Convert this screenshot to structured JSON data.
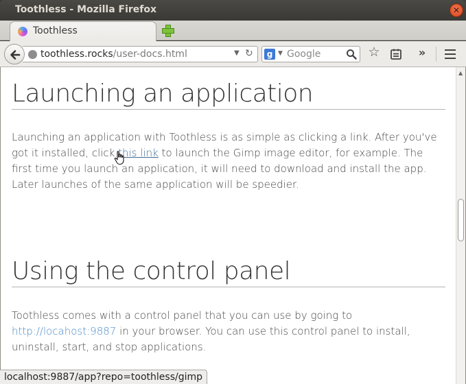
{
  "window": {
    "title": "Toothless - Mozilla Firefox",
    "close_glyph": "✕"
  },
  "tabs": [
    {
      "label": "Toothless",
      "favicon": "toothless-favicon-icon"
    }
  ],
  "navbar": {
    "url_domain": "toothless.rocks",
    "url_path": "/user-docs.html",
    "search_engine": "google-icon",
    "search_placeholder": "Google",
    "overflow_glyph": "»",
    "star_glyph": "☆"
  },
  "content": {
    "heading1": "Launching an application",
    "para1_before": "Launching an application with Toothless is as simple as clicking a link. After you've got it installed, click ",
    "para1_link": "this link",
    "para1_after": " to launch the Gimp image editor, for example. The first time you launch an application, it will need to download and install the app. Later launches of the same application will be speedier.",
    "heading2": "Using the control panel",
    "para2_before": "Toothless comes with a control panel that you can use by going to ",
    "para2_link": "http://locahost:9887",
    "para2_after": " in your browser. You can use this control panel to install, uninstall, start, and stop applications."
  },
  "status": {
    "text": "localhost:9887/app?repo=toothless/gimp"
  },
  "colors": {
    "link": "#4a8ac7",
    "title_bar": "#3c3b37",
    "close_button": "#e5582f"
  }
}
